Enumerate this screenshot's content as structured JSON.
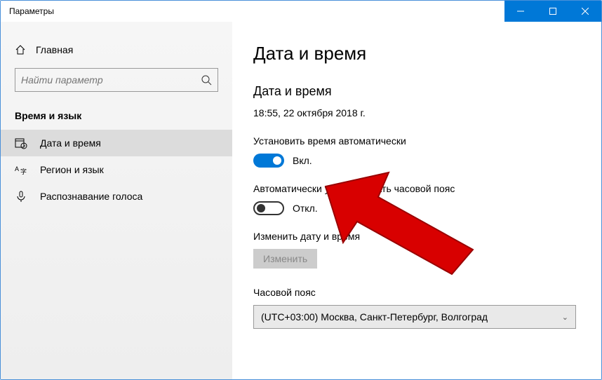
{
  "titlebar": {
    "title": "Параметры"
  },
  "sidebar": {
    "home_label": "Главная",
    "search_placeholder": "Найти параметр",
    "category": "Время и язык",
    "items": [
      {
        "label": "Дата и время"
      },
      {
        "label": "Регион и язык"
      },
      {
        "label": "Распознавание голоса"
      }
    ]
  },
  "main": {
    "page_title": "Дата и время",
    "section_title": "Дата и время",
    "current_datetime": "18:55, 22 октября 2018 г.",
    "auto_time_label": "Установить время автоматически",
    "auto_time_state": "Вкл.",
    "auto_tz_label": "Автоматически устанавливать часовой пояс",
    "auto_tz_state": "Откл.",
    "change_dt_label": "Изменить дату и время",
    "change_btn": "Изменить",
    "tz_label": "Часовой пояс",
    "tz_value": "(UTC+03:00) Москва, Санкт-Петербург, Волгоград"
  }
}
